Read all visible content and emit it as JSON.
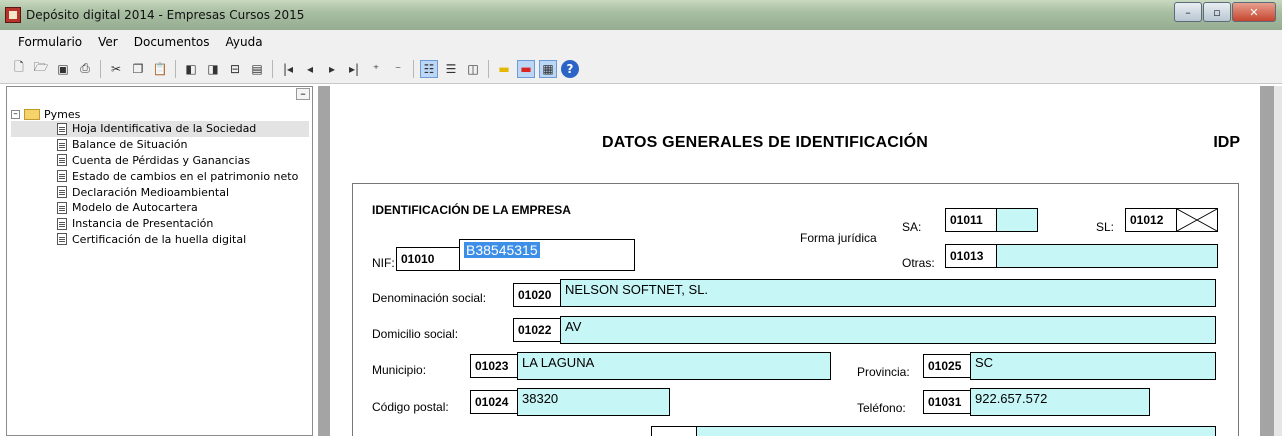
{
  "window": {
    "title": "Depósito digital 2014 - Empresas Cursos 2015"
  },
  "menu": [
    "Formulario",
    "Ver",
    "Documentos",
    "Ayuda"
  ],
  "toolbar": [
    "new-icon",
    "open-icon",
    "save-icon",
    "print-icon",
    "sep",
    "cut-icon",
    "copy-icon",
    "paste-icon",
    "sep",
    "doc-prev-icon",
    "doc-next-icon",
    "doc-fit-icon",
    "doc-info-icon",
    "sep",
    "first-icon",
    "prev-icon",
    "next-icon",
    "last-icon",
    "decimals-add-icon",
    "decimals-remove-icon",
    "sep",
    "tree-view-icon",
    "list-view-icon",
    "columns-icon",
    "sep",
    "yellow-box-icon",
    "red-box-icon",
    "form-icon",
    "help-icon"
  ],
  "tree": {
    "root": "Pymes",
    "items": [
      "Hoja Identificativa de la Sociedad",
      "Balance de Situación",
      "Cuenta de Pérdidas y Ganancias",
      "Estado de cambios en el patrimonio neto",
      "Declaración Medioambiental",
      "Modelo de Autocartera",
      "Instancia de Presentación",
      "Certificación de la huella digital"
    ],
    "selected_index": 0
  },
  "form": {
    "heading": "DATOS GENERALES DE IDENTIFICACIÓN",
    "code": "IDP",
    "section_title": "IDENTIFICACIÓN DE LA EMPRESA",
    "nif_label": "NIF:",
    "nif_code": "01010",
    "nif_value": "B38545315",
    "forma_juridica_label": "Forma jurídica",
    "sa_label": "SA:",
    "sa_code": "01011",
    "sa_value": "",
    "sl_label": "SL:",
    "sl_code": "01012",
    "sl_checked": true,
    "otras_label": "Otras:",
    "otras_code": "01013",
    "otras_value": "",
    "denominacion_label": "Denominación social:",
    "denominacion_code": "01020",
    "denominacion_value": "NELSON SOFTNET, SL.",
    "domicilio_label": "Domicilio social:",
    "domicilio_code": "01022",
    "domicilio_value": "AV",
    "municipio_label": "Municipio:",
    "municipio_code": "01023",
    "municipio_value": "LA LAGUNA",
    "provincia_label": "Provincia:",
    "provincia_code": "01025",
    "provincia_value": "SC",
    "cp_label": "Código postal:",
    "cp_code": "01024",
    "cp_value": "38320",
    "telefono_label": "Teléfono:",
    "telefono_code": "01031",
    "telefono_value": "922.657.572"
  },
  "colors": {
    "field_fill": "#c6f6f6",
    "selection": "#3d8ee6"
  }
}
